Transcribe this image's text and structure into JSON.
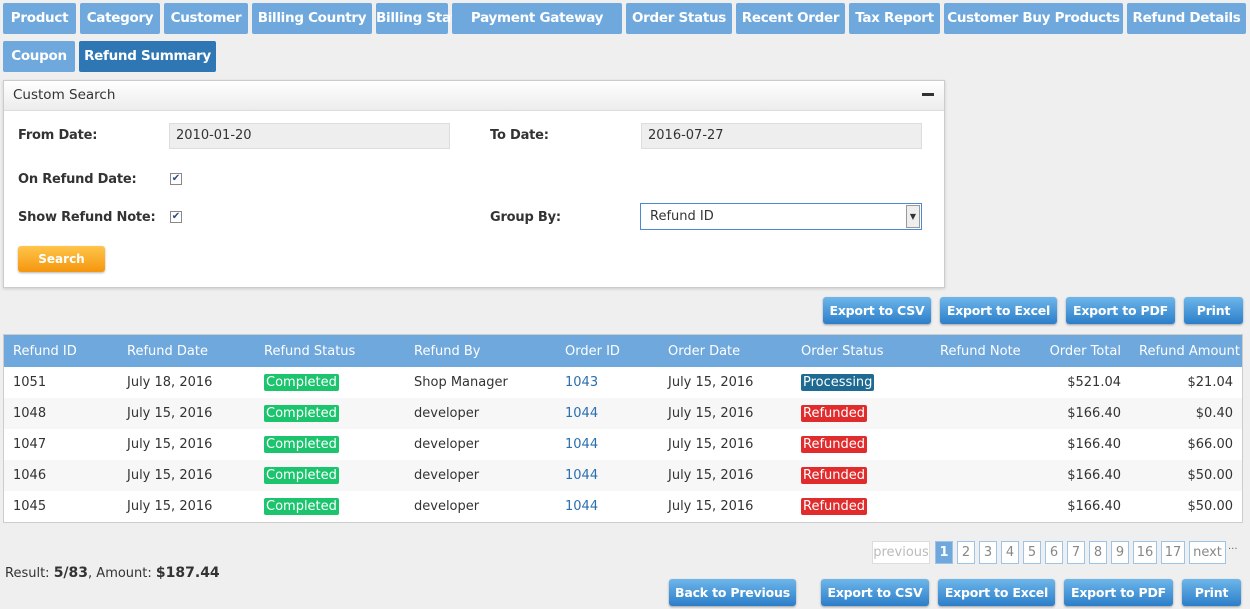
{
  "tabs": [
    "Product",
    "Category",
    "Customer",
    "Billing Country",
    "Billing State",
    "Payment Gateway",
    "Order Status",
    "Recent Order",
    "Tax Report",
    "Customer Buy Products",
    "Refund Details",
    "Coupon",
    "Refund Summary"
  ],
  "active_tab": "Refund Summary",
  "search": {
    "title": "Custom Search",
    "from_label": "From Date:",
    "from_value": "2010-01-20",
    "to_label": "To Date:",
    "to_value": "2016-07-27",
    "on_refund_label": "On Refund Date:",
    "on_refund_checked": true,
    "show_note_label": "Show Refund Note:",
    "show_note_checked": true,
    "group_label": "Group By:",
    "group_value": "Refund ID",
    "search_label": "Search"
  },
  "export": {
    "csv": "Export to CSV",
    "excel": "Export to Excel",
    "pdf": "Export to PDF",
    "print": "Print",
    "back": "Back to Previous"
  },
  "table": {
    "headers": [
      "Refund ID",
      "Refund Date",
      "Refund Status",
      "Refund By",
      "Order ID",
      "Order Date",
      "Order Status",
      "Refund Note",
      "Order Total",
      "Refund Amount"
    ],
    "rows": [
      [
        "1051",
        "July 18, 2016",
        "Completed",
        "Shop Manager",
        "1043",
        "July 15, 2016",
        "Processing",
        "",
        "$521.04",
        "$21.04"
      ],
      [
        "1048",
        "July 15, 2016",
        "Completed",
        "developer",
        "1044",
        "July 15, 2016",
        "Refunded",
        "",
        "$166.40",
        "$0.40"
      ],
      [
        "1047",
        "July 15, 2016",
        "Completed",
        "developer",
        "1044",
        "July 15, 2016",
        "Refunded",
        "",
        "$166.40",
        "$66.00"
      ],
      [
        "1046",
        "July 15, 2016",
        "Completed",
        "developer",
        "1044",
        "July 15, 2016",
        "Refunded",
        "",
        "$166.40",
        "$50.00"
      ],
      [
        "1045",
        "July 15, 2016",
        "Completed",
        "developer",
        "1044",
        "July 15, 2016",
        "Refunded",
        "",
        "$166.40",
        "$50.00"
      ]
    ]
  },
  "colors": {
    "tab": "#6fa8dc",
    "tab_active": "#2f77b4",
    "completed": "#1bc46d",
    "refunded": "#e02c2c",
    "processing": "#1e6a92"
  },
  "pagination": {
    "previous": "previous",
    "pages": [
      "1",
      "2",
      "3",
      "4",
      "5",
      "6",
      "7",
      "8",
      "9",
      "16",
      "17"
    ],
    "next": "next",
    "more": "···",
    "current": "1"
  },
  "result": {
    "label": "Result: ",
    "count": "5/83",
    "amount_label": ", Amount: ",
    "amount": "$187.44"
  }
}
